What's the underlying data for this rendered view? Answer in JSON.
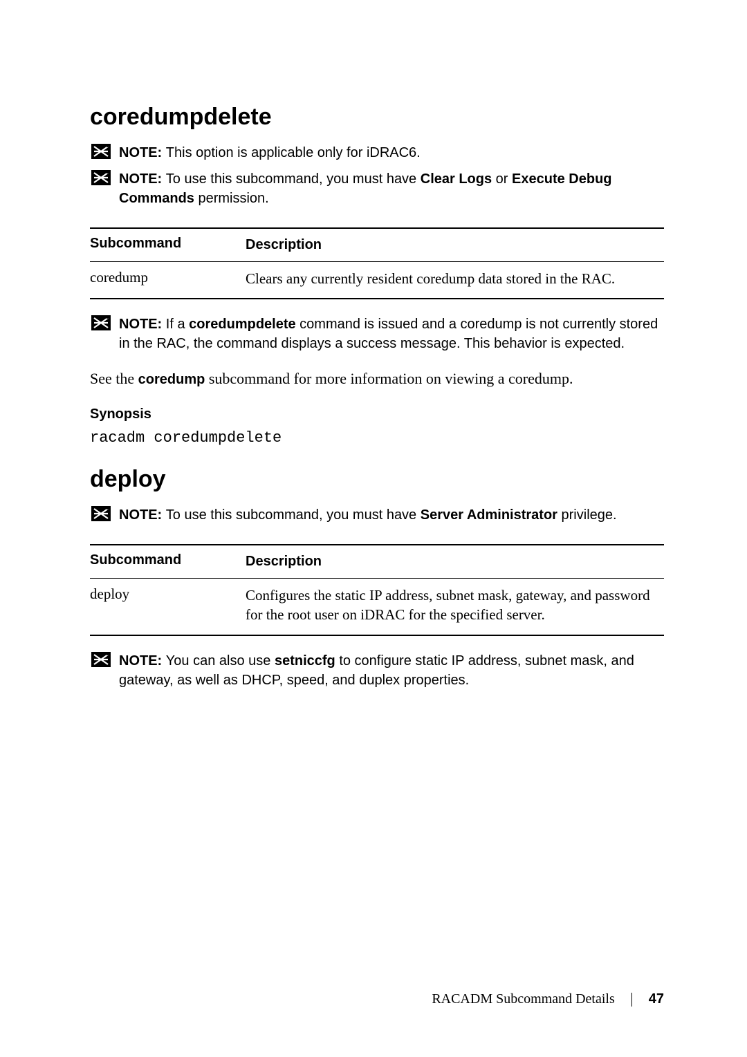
{
  "section1": {
    "heading": "coredumpdelete",
    "note1_label": "NOTE: ",
    "note1_text": "This option is applicable only for iDRAC6.",
    "note2_label": "NOTE: ",
    "note2_pre": "To use this subcommand, you must have ",
    "note2_bold1": "Clear Logs",
    "note2_mid": " or ",
    "note2_bold2": "Execute Debug Commands",
    "note2_post": " permission.",
    "table": {
      "header_sub": "Subcommand",
      "header_desc": "Description",
      "row_sub": "coredump",
      "row_desc": "Clears any currently resident coredump data stored in the RAC."
    },
    "note3_label": "NOTE: ",
    "note3_pre": "If a ",
    "note3_bold": "coredumpdelete",
    "note3_post": " command is issued and a coredump is not currently stored in the RAC, the command displays a success message. This behavior is expected.",
    "body_pre": "See the ",
    "body_bold": "coredump",
    "body_post": " subcommand for more information on viewing a coredump.",
    "synopsis_label": "Synopsis",
    "synopsis_code": "racadm coredumpdelete"
  },
  "section2": {
    "heading": "deploy",
    "note1_label": "NOTE: ",
    "note1_pre": "To use this subcommand, you must have ",
    "note1_bold": "Server Administrator",
    "note1_post": " privilege.",
    "table": {
      "header_sub": "Subcommand",
      "header_desc": "Description",
      "row_sub": "deploy",
      "row_desc": "Configures the static IP address, subnet mask, gateway, and password for the root user on iDRAC for the specified server."
    },
    "note2_label": "NOTE: ",
    "note2_pre": "You can also use ",
    "note2_bold": "setniccfg",
    "note2_post": " to configure static IP address, subnet mask, and gateway, as well as DHCP, speed, and duplex properties."
  },
  "footer": {
    "title": "RACADM Subcommand Details",
    "page": "47"
  }
}
